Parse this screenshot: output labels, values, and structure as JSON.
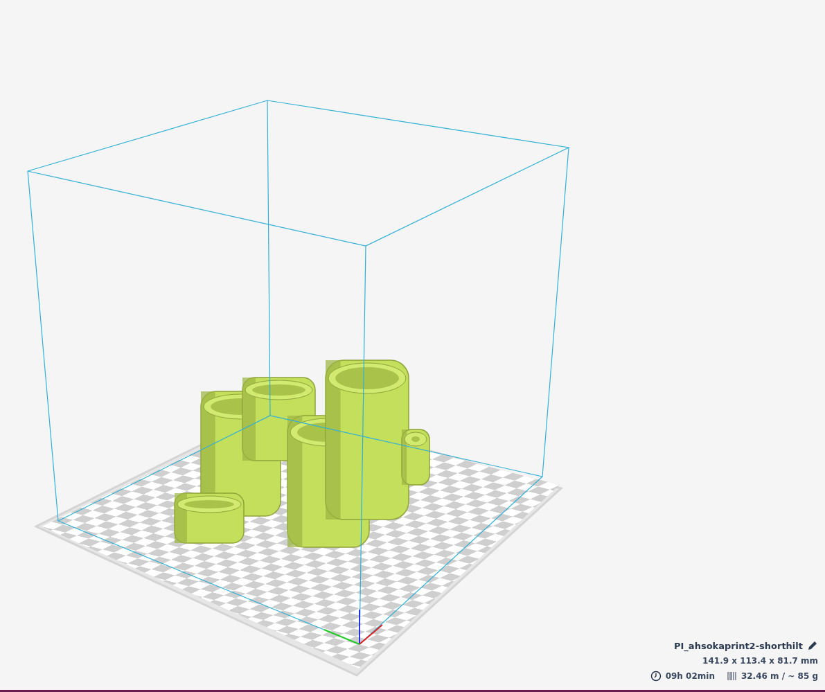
{
  "job": {
    "name": "PI_ahsokaprint2-shorthilt",
    "dimensions": "141.9 x 113.4 x 81.7 mm",
    "print_time": "09h 02min",
    "material": "32.46 m / ~ 85 g"
  }
}
